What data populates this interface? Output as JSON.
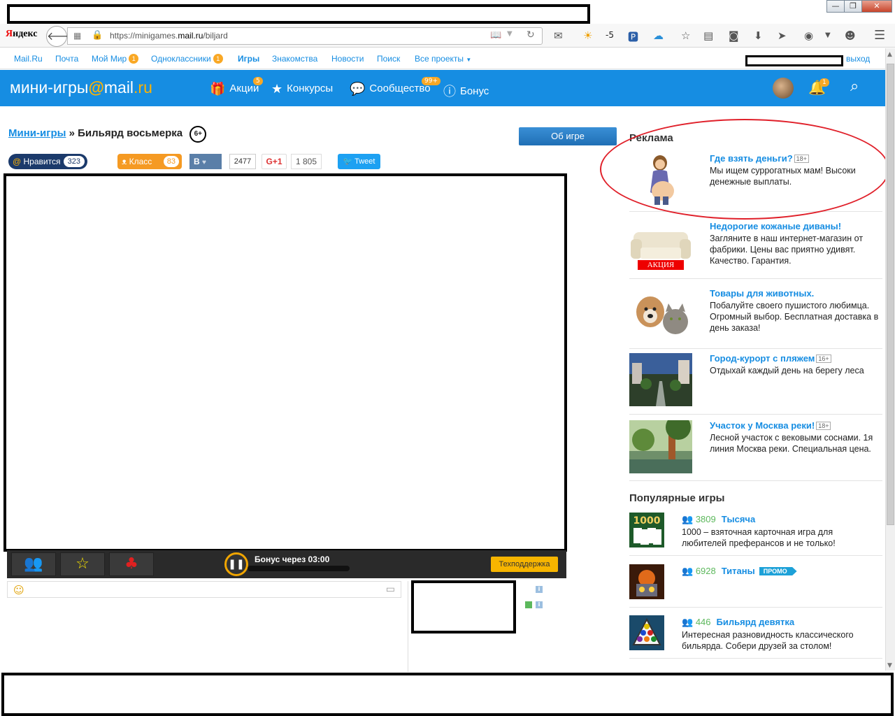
{
  "window": {
    "btn_minimize": "—",
    "btn_restore": "❐",
    "btn_close": "✕"
  },
  "browser": {
    "logo_first": "Я",
    "logo_rest": "ндекс",
    "url_prefix": "https://minigames.",
    "url_domain": "mail.ru",
    "url_path": "/biljard",
    "weather_temp": "-5"
  },
  "toplinks": {
    "items": [
      "Mail.Ru",
      "Почта",
      "Мой Мир",
      "Одноклассники",
      "Игры",
      "Знакомства",
      "Новости",
      "Поиск",
      "Все проекты"
    ],
    "moi_mir_badge": "1",
    "ok_badge": "1",
    "logout": "выход"
  },
  "header": {
    "logo_text": "мини-игры",
    "logo_at": "@",
    "logo_mail": "mail",
    "logo_dot_ru": ".ru",
    "nav": {
      "akcii": "Акции",
      "akcii_badge": "5",
      "konkursy": "Конкурсы",
      "soobshestvo": "Сообщество",
      "soobshestvo_badge": "99+",
      "bonus": "Бонус",
      "bell_badge": "1"
    }
  },
  "breadcrumb": {
    "parent": "Мини-игры",
    "sep": "»",
    "current": "Бильярд восьмерка",
    "age": "6+"
  },
  "about_button": "Об игре",
  "social": {
    "like_label": "Нравится",
    "like_count": "323",
    "ok_label": "Класс",
    "ok_count": "83",
    "vk_label": "В",
    "vk_count": "2477",
    "gplus_label": "G+1",
    "gplus_count": "1 805",
    "tweet_label": "Tweet"
  },
  "gamebar": {
    "bonus_label": "Бонус через",
    "bonus_time": "03:00",
    "support": "Техподдержка"
  },
  "ads": {
    "title": "Реклама",
    "items": [
      {
        "title": "Где взять деньги?",
        "age": "18+",
        "desc": "Мы ищем суррогатных мам! Высоки денежные выплаты."
      },
      {
        "title": "Недорогие кожаные диваны!",
        "age": "",
        "desc": "Загляните в наш интернет-магазин от фабрики. Цены вас приятно удивят. Качество. Гарантия.",
        "badge": "АКЦИЯ"
      },
      {
        "title": "Товары для животных.",
        "age": "",
        "desc": "Побалуйте своего пушистого любимца. Огромный выбор. Бесплатная доставка в день заказа!"
      },
      {
        "title": "Город-курорт с пляжем",
        "age": "16+",
        "desc": "Отдыхай каждый день на берегу леса"
      },
      {
        "title": "Участок у Москва реки!",
        "age": "18+",
        "desc": "Лесной участок с вековыми соснами. 1я линия Москва реки. Специальная цена."
      }
    ]
  },
  "popular": {
    "title": "Популярные игры",
    "items": [
      {
        "players": "3809",
        "name": "Тысяча",
        "desc": "1000 – взяточная карточная игра для любителей преферансов и не только!",
        "thumb_text": "1000"
      },
      {
        "players": "6928",
        "name": "Титаны",
        "promo": "ПРОМО",
        "desc": ""
      },
      {
        "players": "446",
        "name": "Бильярд девятка",
        "desc": "Интересная разновидность классического бильярда. Собери друзей за столом!"
      }
    ]
  }
}
